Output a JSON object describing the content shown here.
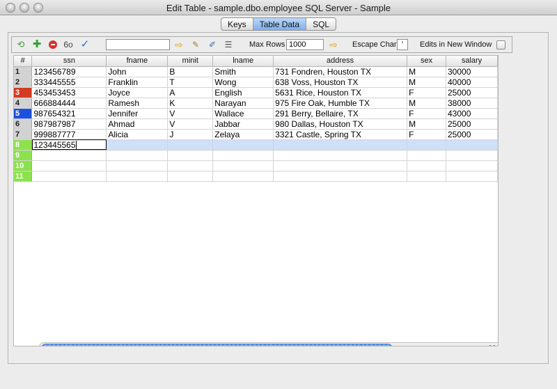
{
  "window": {
    "title": "Edit Table - sample.dbo.employee SQL Server - Sample"
  },
  "tabs": [
    {
      "label": "Keys",
      "active": false
    },
    {
      "label": "Table Data",
      "active": true
    },
    {
      "label": "SQL",
      "active": false
    }
  ],
  "toolbar": {
    "icons": [
      "refresh-icon",
      "add-row-icon",
      "delete-row-icon",
      "find-icon",
      "commit-icon",
      "go-arrow-icon",
      "clear-icon",
      "edit-icon",
      "format-icon"
    ],
    "filter_value": "",
    "max_rows_label": "Max Rows",
    "max_rows_value": "1000",
    "escape_char_label": "Escape Char",
    "escape_char_value": "'",
    "edits_in_new_window_label": "Edits in New Window",
    "edits_in_new_window_checked": false
  },
  "table": {
    "columns": [
      "#",
      "ssn",
      "fname",
      "minit",
      "lname",
      "address",
      "sex",
      "salary"
    ],
    "rows": [
      {
        "num": "1",
        "ssn": "123456789",
        "fname": "John",
        "minit": "B",
        "lname": "Smith",
        "address": "731 Fondren, Houston TX",
        "sex": "M",
        "salary": "30000",
        "marker": ""
      },
      {
        "num": "2",
        "ssn": "333445555",
        "fname": "Franklin",
        "minit": "T",
        "lname": "Wong",
        "address": "638 Voss, Houston TX",
        "sex": "M",
        "salary": "40000",
        "marker": ""
      },
      {
        "num": "3",
        "ssn": "453453453",
        "fname": "Joyce",
        "minit": "A",
        "lname": "English",
        "address": "5631 Rice, Houston TX",
        "sex": "F",
        "salary": "25000",
        "marker": "red"
      },
      {
        "num": "4",
        "ssn": "666884444",
        "fname": "Ramesh",
        "minit": "K",
        "lname": "Narayan",
        "address": "975 Fire Oak, Humble TX",
        "sex": "M",
        "salary": "38000",
        "marker": ""
      },
      {
        "num": "5",
        "ssn": "987654321",
        "fname": "Jennifer",
        "minit": "V",
        "lname": "Wallace",
        "address": "291 Berry, Bellaire, TX",
        "sex": "F",
        "salary": "43000",
        "marker": "blue"
      },
      {
        "num": "6",
        "ssn": "987987987",
        "fname": "Ahmad",
        "minit": "V",
        "lname": "Jabbar",
        "address": "980 Dallas, Houston TX",
        "sex": "M",
        "salary": "25000",
        "marker": ""
      },
      {
        "num": "7",
        "ssn": "999887777",
        "fname": "Alicia",
        "minit": "J",
        "lname": "Zelaya",
        "address": "3321 Castle, Spring TX",
        "sex": "F",
        "salary": "25000",
        "marker": ""
      },
      {
        "num": "8",
        "ssn": "123445565",
        "fname": "",
        "minit": "",
        "lname": "",
        "address": "",
        "sex": "",
        "salary": "",
        "marker": "green"
      },
      {
        "num": "9",
        "ssn": "",
        "fname": "",
        "minit": "",
        "lname": "",
        "address": "",
        "sex": "",
        "salary": "",
        "marker": "green"
      },
      {
        "num": "10",
        "ssn": "",
        "fname": "",
        "minit": "",
        "lname": "",
        "address": "",
        "sex": "",
        "salary": "",
        "marker": "green"
      },
      {
        "num": "11",
        "ssn": "",
        "fname": "",
        "minit": "",
        "lname": "",
        "address": "",
        "sex": "",
        "salary": "",
        "marker": "green"
      }
    ],
    "selected_row": 8
  },
  "colors": {
    "selected_row": "#cfe0f8",
    "new_row_marker": "#8ce24d",
    "deleted_marker": "#d53a22",
    "modified_marker": "#1c51e0"
  }
}
